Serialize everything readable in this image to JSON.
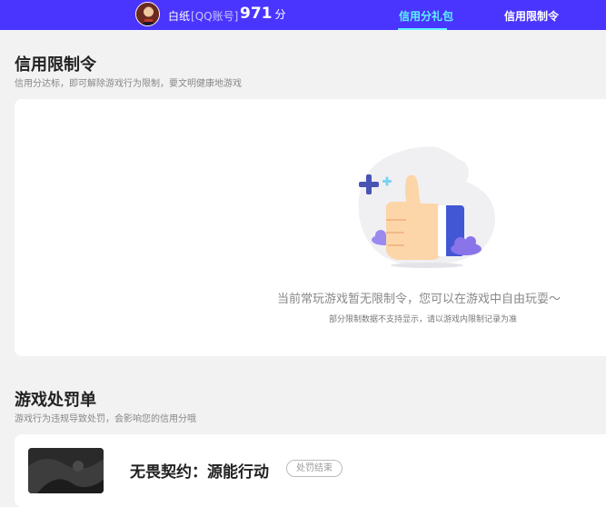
{
  "header": {
    "username": "白纸",
    "account_type": "[QQ账号]",
    "score": "971",
    "score_unit": "分",
    "tabs": [
      {
        "label": "信用分礼包",
        "active": true
      },
      {
        "label": "信用限制令",
        "active": false
      }
    ]
  },
  "restriction_section": {
    "title": "信用限制令",
    "subtitle": "信用分达标，即可解除游戏行为限制，要文明健康地游戏",
    "empty_message": "当前常玩游戏暂无限制令，您可以在游戏中自由玩耍～",
    "empty_note": "部分限制数据不支持显示，请以游戏内限制记录为准"
  },
  "penalty_section": {
    "title": "游戏处罚单",
    "subtitle": "游戏行为违规导致处罚，会影响您的信用分哦",
    "items": [
      {
        "game": "无畏契约：源能行动",
        "status": "处罚结束"
      }
    ]
  },
  "colors": {
    "header_bg": "#4a35ff",
    "active_tab": "#5ff3ff",
    "page_bg": "#f2f2f2"
  }
}
